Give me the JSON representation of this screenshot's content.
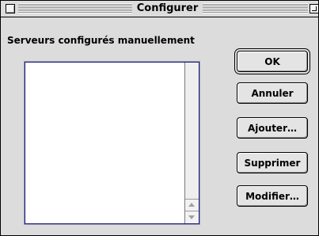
{
  "window": {
    "title": "Configurer"
  },
  "dialog": {
    "group_label": "Serveurs configurés manuellement",
    "servers": [],
    "buttons": {
      "ok": "OK",
      "cancel": "Annuler",
      "add": "Ajouter…",
      "delete": "Supprimer",
      "edit": "Modifier…"
    }
  }
}
